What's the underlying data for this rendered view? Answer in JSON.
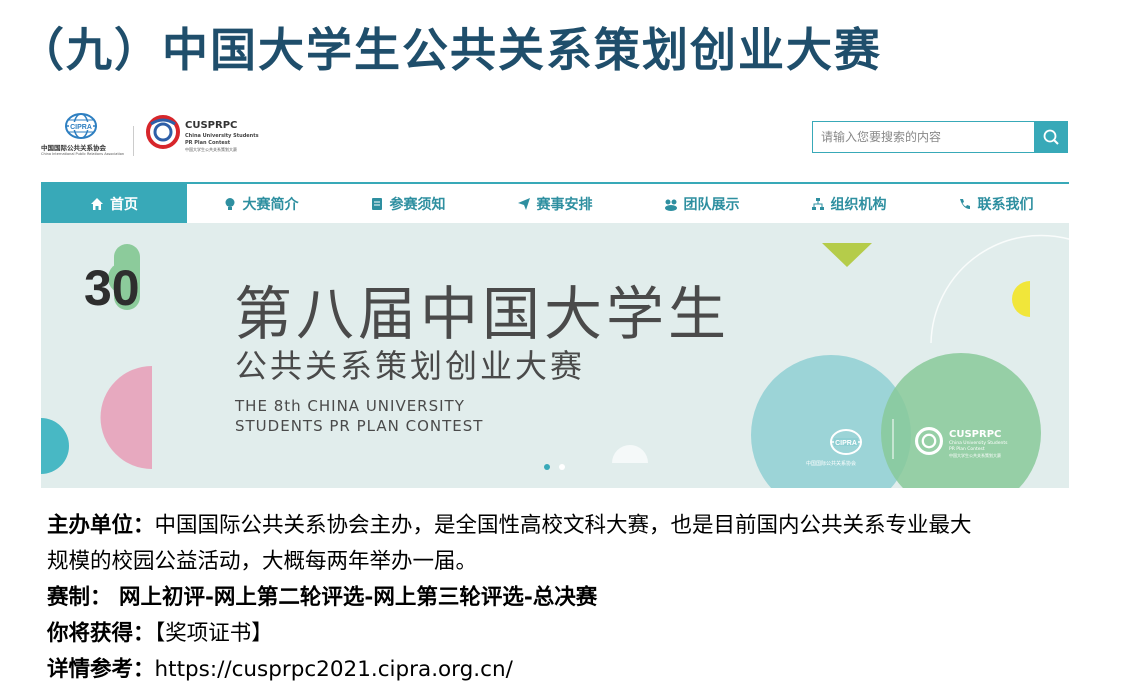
{
  "slide": {
    "title": "（九）中国大学生公共关系策划创业大赛"
  },
  "site": {
    "logos": {
      "cipra_short": "CIPRA",
      "cipra_cn": "中国国际公共关系协会",
      "cipra_en": "China International Public Relations Association",
      "cusprpc_short": "CUSPRPC",
      "cusprpc_en1": "China University Students",
      "cusprpc_en2": "PR Plan Contest",
      "cusprpc_cn": "中国大学生公共关系策划大赛"
    },
    "search": {
      "placeholder": "请输入您要搜索的内容"
    },
    "nav": [
      {
        "label": "首页",
        "icon": "home-icon"
      },
      {
        "label": "大赛简介",
        "icon": "lightbulb-icon"
      },
      {
        "label": "参赛须知",
        "icon": "document-icon"
      },
      {
        "label": "赛事安排",
        "icon": "paper-plane-icon"
      },
      {
        "label": "团队展示",
        "icon": "team-icon"
      },
      {
        "label": "组织机构",
        "icon": "org-chart-icon"
      },
      {
        "label": "联系我们",
        "icon": "phone-icon"
      }
    ],
    "banner": {
      "title_cn": "第八届中国大学生",
      "subtitle_cn": "公共关系策划创业大赛",
      "title_en_line1": "THE 8th CHINA UNIVERSITY",
      "title_en_line2": "STUDENTS PR PLAN CONTEST",
      "badge_number": "30",
      "slide_count": 2,
      "active_slide": 1
    },
    "colors": {
      "accent": "#38a9b8",
      "banner_bg": "#e1edec"
    }
  },
  "description": {
    "organizer_label": "主办单位：",
    "organizer_text_line1": "中国国际公共关系协会主办，是全国性高校文科大赛，也是目前国内公共关系专业最大",
    "organizer_text_line2": "规模的校园公益活动，大概每两年举办一届。",
    "format_label": "赛制：",
    "format_text": " 网上初评-网上第二轮评选-网上第三轮评选-总决赛",
    "reward_label": "你将获得：",
    "reward_text": "【奖项证书】",
    "details_label": "详情参考：",
    "details_url": "https://cusprpc2021.cipra.org.cn/"
  }
}
